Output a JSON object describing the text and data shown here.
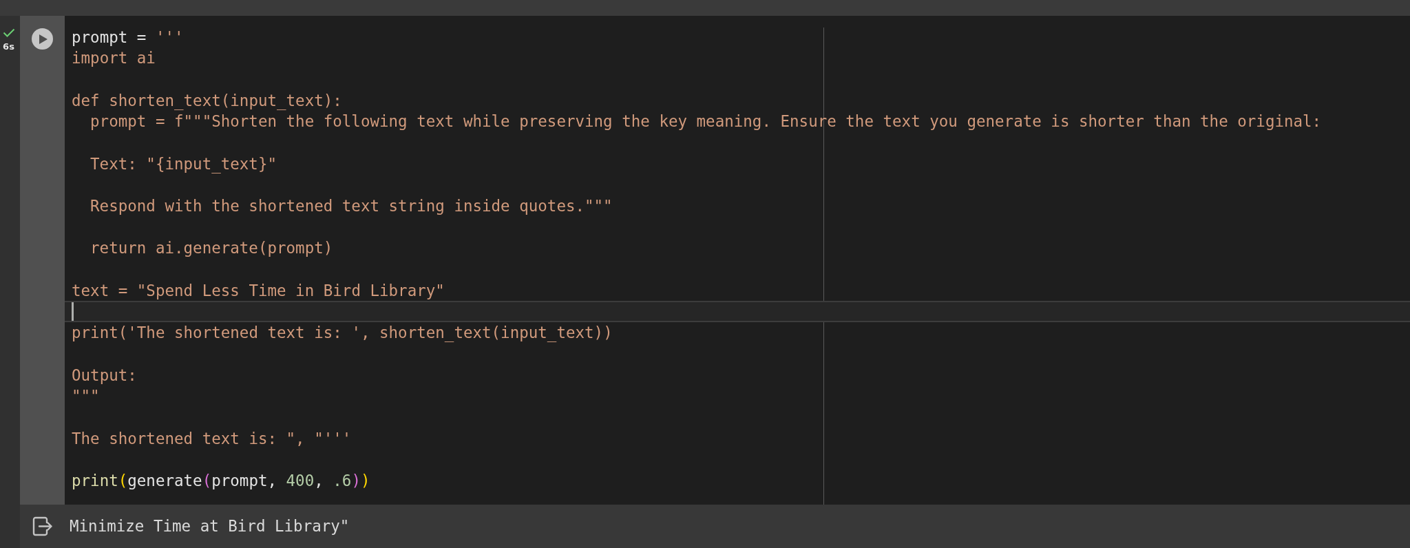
{
  "cell": {
    "execution": {
      "succeeded": true,
      "duration": "6s"
    },
    "code": {
      "lines": [
        {
          "current": false,
          "tokens": [
            {
              "kind": "plain",
              "text": "prompt = "
            },
            {
              "kind": "string",
              "text": "'''"
            }
          ]
        },
        {
          "current": false,
          "tokens": [
            {
              "kind": "string",
              "text": "import ai"
            }
          ]
        },
        {
          "current": false
        },
        {
          "current": false,
          "tokens": [
            {
              "kind": "string",
              "text": "def shorten_text(input_text):"
            }
          ],
          "children": [
            {
              "current": false,
              "tokens": [
                {
                  "kind": "string",
                  "text": "prompt = f\"\"\"Shorten the following text while preserving the key meaning. Ensure the text you generate is shorter than the original:"
                }
              ]
            },
            {
              "current": false
            },
            {
              "current": false,
              "tokens": [
                {
                  "kind": "string",
                  "text": "Text: \"{input_text}\""
                }
              ]
            },
            {
              "current": false
            },
            {
              "current": false,
              "tokens": [
                {
                  "kind": "string",
                  "text": "Respond with the shortened text string inside quotes.\"\"\""
                }
              ]
            },
            {
              "current": false
            },
            {
              "current": false,
              "tokens": [
                {
                  "kind": "string",
                  "text": "return ai.generate(prompt)"
                }
              ]
            }
          ]
        },
        {
          "current": false
        },
        {
          "current": false,
          "tokens": [
            {
              "kind": "string",
              "text": "text = \"Spend Less Time in Bird Library\""
            }
          ]
        },
        {
          "current": true
        },
        {
          "current": false,
          "tokens": [
            {
              "kind": "string",
              "text": "print('The shortened text is: ', shorten_text(input_text))"
            }
          ]
        },
        {
          "current": false
        },
        {
          "current": false,
          "tokens": [
            {
              "kind": "string",
              "text": "Output:"
            }
          ]
        },
        {
          "current": false,
          "tokens": [
            {
              "kind": "string",
              "text": "\"\"\""
            }
          ]
        },
        {
          "current": false
        },
        {
          "current": false,
          "tokens": [
            {
              "kind": "string",
              "text": "The shortened text is: \", \"'''"
            }
          ]
        },
        {
          "current": false
        },
        {
          "current": false,
          "tokens": [
            {
              "kind": "function",
              "text": "print"
            },
            {
              "kind": "bracket1",
              "text": "("
            },
            {
              "kind": "plain",
              "text": "generate"
            },
            {
              "kind": "bracket2",
              "text": "("
            },
            {
              "kind": "plain",
              "text": "prompt, "
            },
            {
              "kind": "number",
              "text": "400"
            },
            {
              "kind": "plain",
              "text": ", "
            },
            {
              "kind": "number",
              "text": ".6"
            },
            {
              "kind": "bracket2",
              "text": ")"
            },
            {
              "kind": "bracket1",
              "text": ")"
            }
          ]
        }
      ]
    },
    "output": {
      "text": "Minimize Time at Bird Library\""
    }
  }
}
